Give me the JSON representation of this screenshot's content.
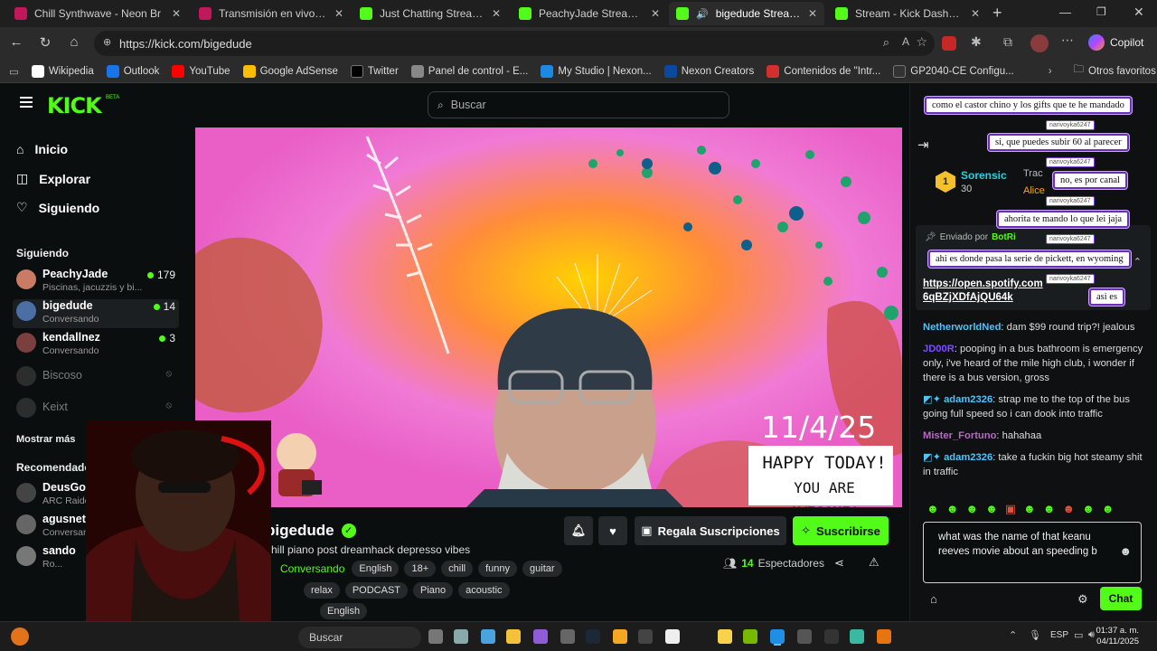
{
  "browser": {
    "tabs": [
      {
        "title": "Chill Synthwave - Neon Br",
        "icon_color": "#c2185b"
      },
      {
        "title": "Transmisión en vivo - You",
        "icon_color": "#c2185b"
      },
      {
        "title": "Just Chatting Streaming -",
        "icon_color": "#53fc18"
      },
      {
        "title": "PeachyJade Stream - Wat",
        "icon_color": "#53fc18"
      },
      {
        "title": "bigedude Stream - W",
        "icon_color": "#53fc18"
      },
      {
        "title": "Stream - Kick Dashboard",
        "icon_color": "#53fc18"
      }
    ],
    "url": "https://kick.com/bigedude",
    "copilot_label": "Copilot",
    "bookmarks": [
      {
        "label": "Wikipedia",
        "color": "#ffffff"
      },
      {
        "label": "Outlook",
        "color": "#1a73e8"
      },
      {
        "label": "YouTube",
        "color": "#ff0000"
      },
      {
        "label": "Google AdSense",
        "color": "#fbbc04"
      },
      {
        "label": "Twitter",
        "color": "#000000"
      },
      {
        "label": "Panel de control - E...",
        "color": "#888888"
      },
      {
        "label": "My Studio | Nexon...",
        "color": "#1e88e5"
      },
      {
        "label": "Nexon Creators",
        "color": "#0d47a1"
      },
      {
        "label": "Contenidos de \"Intr...",
        "color": "#d32f2f"
      },
      {
        "label": "GP2040-CE Configu...",
        "color": "#333333"
      }
    ],
    "other_favorites": "Otros favoritos"
  },
  "kick": {
    "logo": "KICK",
    "logo_badge": "BETA",
    "search_placeholder": "Buscar",
    "nav": {
      "home": "Inicio",
      "explore": "Explorar",
      "following": "Siguiendo"
    },
    "following_section": "Siguiendo",
    "following_channels": [
      {
        "name": "PeachyJade",
        "sub": "Piscinas, jacuzzis y bi...",
        "viewers": "179",
        "color": "#c97b63"
      },
      {
        "name": "bigedude",
        "sub": "Conversando",
        "viewers": "14",
        "color": "#4a6fa5"
      },
      {
        "name": "kendallnez",
        "sub": "Conversando",
        "viewers": "3",
        "color": "#7b3f3f"
      }
    ],
    "offline_channels": [
      "Biscoso",
      "Keixt"
    ],
    "show_more": "Mostrar más",
    "recommended_section": "Recomendado",
    "recommended": [
      {
        "name": "DeusGow",
        "sub": "ARC Raiders"
      },
      {
        "name": "agusneta",
        "sub": "Conversando"
      },
      {
        "name": "sando",
        "sub": "Ro..."
      }
    ],
    "player_overlay": {
      "date": "11/4/25",
      "card_line1": "HAPPY TODAY!",
      "card_line2": "YOU ARE AWESOME!"
    },
    "stream": {
      "channel": "bigedude",
      "title": "chill piano post dreamhack depresso vibes",
      "category": "Conversando",
      "tags_row1": [
        "English",
        "18+",
        "chill",
        "funny",
        "guitar"
      ],
      "tags_row2": [
        "relax",
        "PODCAST",
        "Piano",
        "acoustic"
      ],
      "tags_row3": [
        "English"
      ],
      "gift_button": "Regala Suscripciones",
      "subscribe_button": "Suscribirse",
      "viewers_count": "14",
      "viewers_label": "Espectadores"
    },
    "chat": {
      "top_gifter": {
        "rank": "1",
        "name": "Sorensic",
        "amount": "30"
      },
      "second": "Trac",
      "third": "Alice",
      "pinned_label": "Enviado por",
      "pinned_by": "BotRi",
      "pinned_link": "https://open.spotify.com 6qBZjXDfAjQU64k",
      "messages": [
        {
          "user": "NetherworldNed",
          "color": "#4fc3f7",
          "text": "dam $99 round trip?! jealous"
        },
        {
          "user": "JD00R",
          "color": "#7c4dff",
          "text": "pooping in a bus bathroom is emergency only, i've heard of the mile high club, i wonder if there is a bus version, gross"
        },
        {
          "user": "adam2326",
          "color": "#4fc3f7",
          "text": "strap me to the top of the bus going full speed so i can dook into traffic"
        },
        {
          "user": "Mister_Fortuno",
          "color": "#ba68c8",
          "text": "hahahaa"
        },
        {
          "user": "adam2326",
          "color": "#4fc3f7",
          "text": "take a fuckin big hot steamy shit in traffic"
        }
      ],
      "overlay_messages": [
        "como el castor chino y los gifts que te he mandado",
        "si, que puedes subir 60 al parecer",
        "no, es por canal",
        "ahorita te mando lo que lei jaja",
        "ahi es donde pasa la serie de pickett, en wyoming",
        "asi es"
      ],
      "overlay_tag": "narivoyka6247",
      "input_text": "what was the name of that keanu reeves movie about an speeding b",
      "send_button": "Chat"
    }
  },
  "taskbar": {
    "search": "Buscar",
    "lang": "ESP",
    "time": "01:37 a. m.",
    "date": "04/11/2025"
  }
}
